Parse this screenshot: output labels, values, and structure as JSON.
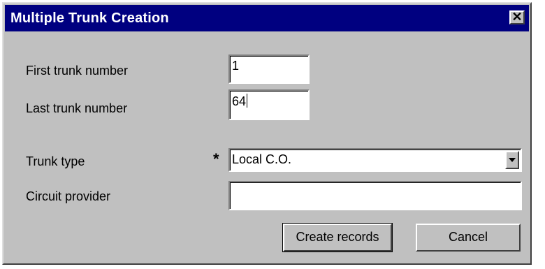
{
  "window": {
    "title": "Multiple Trunk Creation",
    "close_glyph": "✕"
  },
  "form": {
    "first_trunk_label": "First trunk number",
    "first_trunk_value": "1",
    "last_trunk_label": "Last trunk number",
    "last_trunk_value": "64",
    "trunk_type_label": "Trunk type",
    "trunk_type_required_marker": "*",
    "trunk_type_value": "Local C.O.",
    "circuit_provider_label": "Circuit provider",
    "circuit_provider_value": ""
  },
  "buttons": {
    "create_records": "Create records",
    "cancel": "Cancel"
  },
  "colors": {
    "titlebar": "#000080",
    "dialog_face": "#c0c0c0"
  }
}
